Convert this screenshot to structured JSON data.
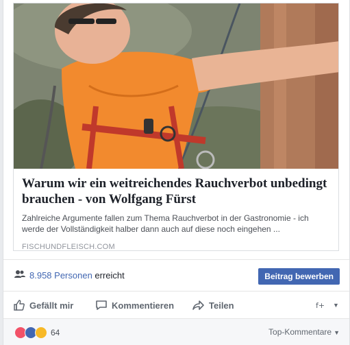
{
  "link": {
    "title": "Warum wir ein weitreichendes Rauchverbot unbedingt brauchen - von Wolfgang Fürst",
    "description": "Zahlreiche Argumente fallen zum Thema Rauchverbot in der Gastronomie - ich werde der Vollständigkeit halber dann auch auf diese noch eingehen ...",
    "domain": "FISCHUNDFLEISCH.COM",
    "image_alt": "Man in orange shirt with climbing harness next to tree"
  },
  "reach": {
    "count": "8.958 Personen",
    "suffix": " erreicht",
    "boost_label": "Beitrag bewerben"
  },
  "actions": {
    "like_label": "Gefällt mir",
    "comment_label": "Kommentieren",
    "share_label": "Teilen"
  },
  "reactions": {
    "count": "64",
    "sort_label": "Top-Kommentare"
  },
  "colors": {
    "accent": "#4267b2",
    "background": "#e9ebee"
  }
}
